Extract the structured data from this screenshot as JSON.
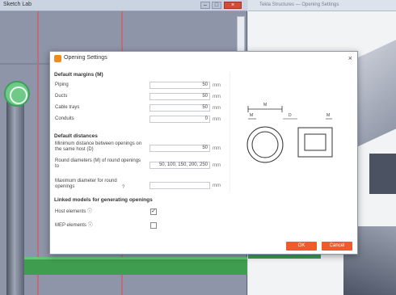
{
  "background": {
    "left_window": {
      "title": "Sketch Lab"
    },
    "right_window": {
      "title": "Tekla Structures — Opening Settings"
    }
  },
  "dialog": {
    "title": "Opening Settings",
    "close_label": "×",
    "sections": {
      "margins": "Default margins (M)",
      "distances": "Default distances",
      "linked": "Linked models for generating openings"
    },
    "margins": [
      {
        "label": "Piping",
        "value": "50",
        "unit": "mm"
      },
      {
        "label": "Ducts",
        "value": "50",
        "unit": "mm"
      },
      {
        "label": "Cable trays",
        "value": "50",
        "unit": "mm"
      },
      {
        "label": "Conduits",
        "value": "0",
        "unit": "mm"
      }
    ],
    "distances": [
      {
        "label": "Minimum distance between openings on the same host (D)",
        "value": "50",
        "unit": "mm"
      },
      {
        "label": "Round diameters (M) of round openings to",
        "value": "50, 100, 150, 200, 250",
        "unit": "mm"
      },
      {
        "label": "Maximum diameter for round openings",
        "value": "",
        "unit": "mm"
      }
    ],
    "help_icon": "?",
    "linked_models": [
      {
        "label": "Host elements ⓘ",
        "checked": true
      },
      {
        "label": "MEP elements ⓘ",
        "checked": false
      }
    ],
    "diagram": {
      "top_label": "M",
      "left_label": "M",
      "mid_label": "D",
      "right_label": "M"
    },
    "buttons": {
      "ok": "OK",
      "cancel": "Cancel"
    },
    "colors": {
      "accent": "#f15a2b",
      "logo": "#f08a24"
    }
  }
}
